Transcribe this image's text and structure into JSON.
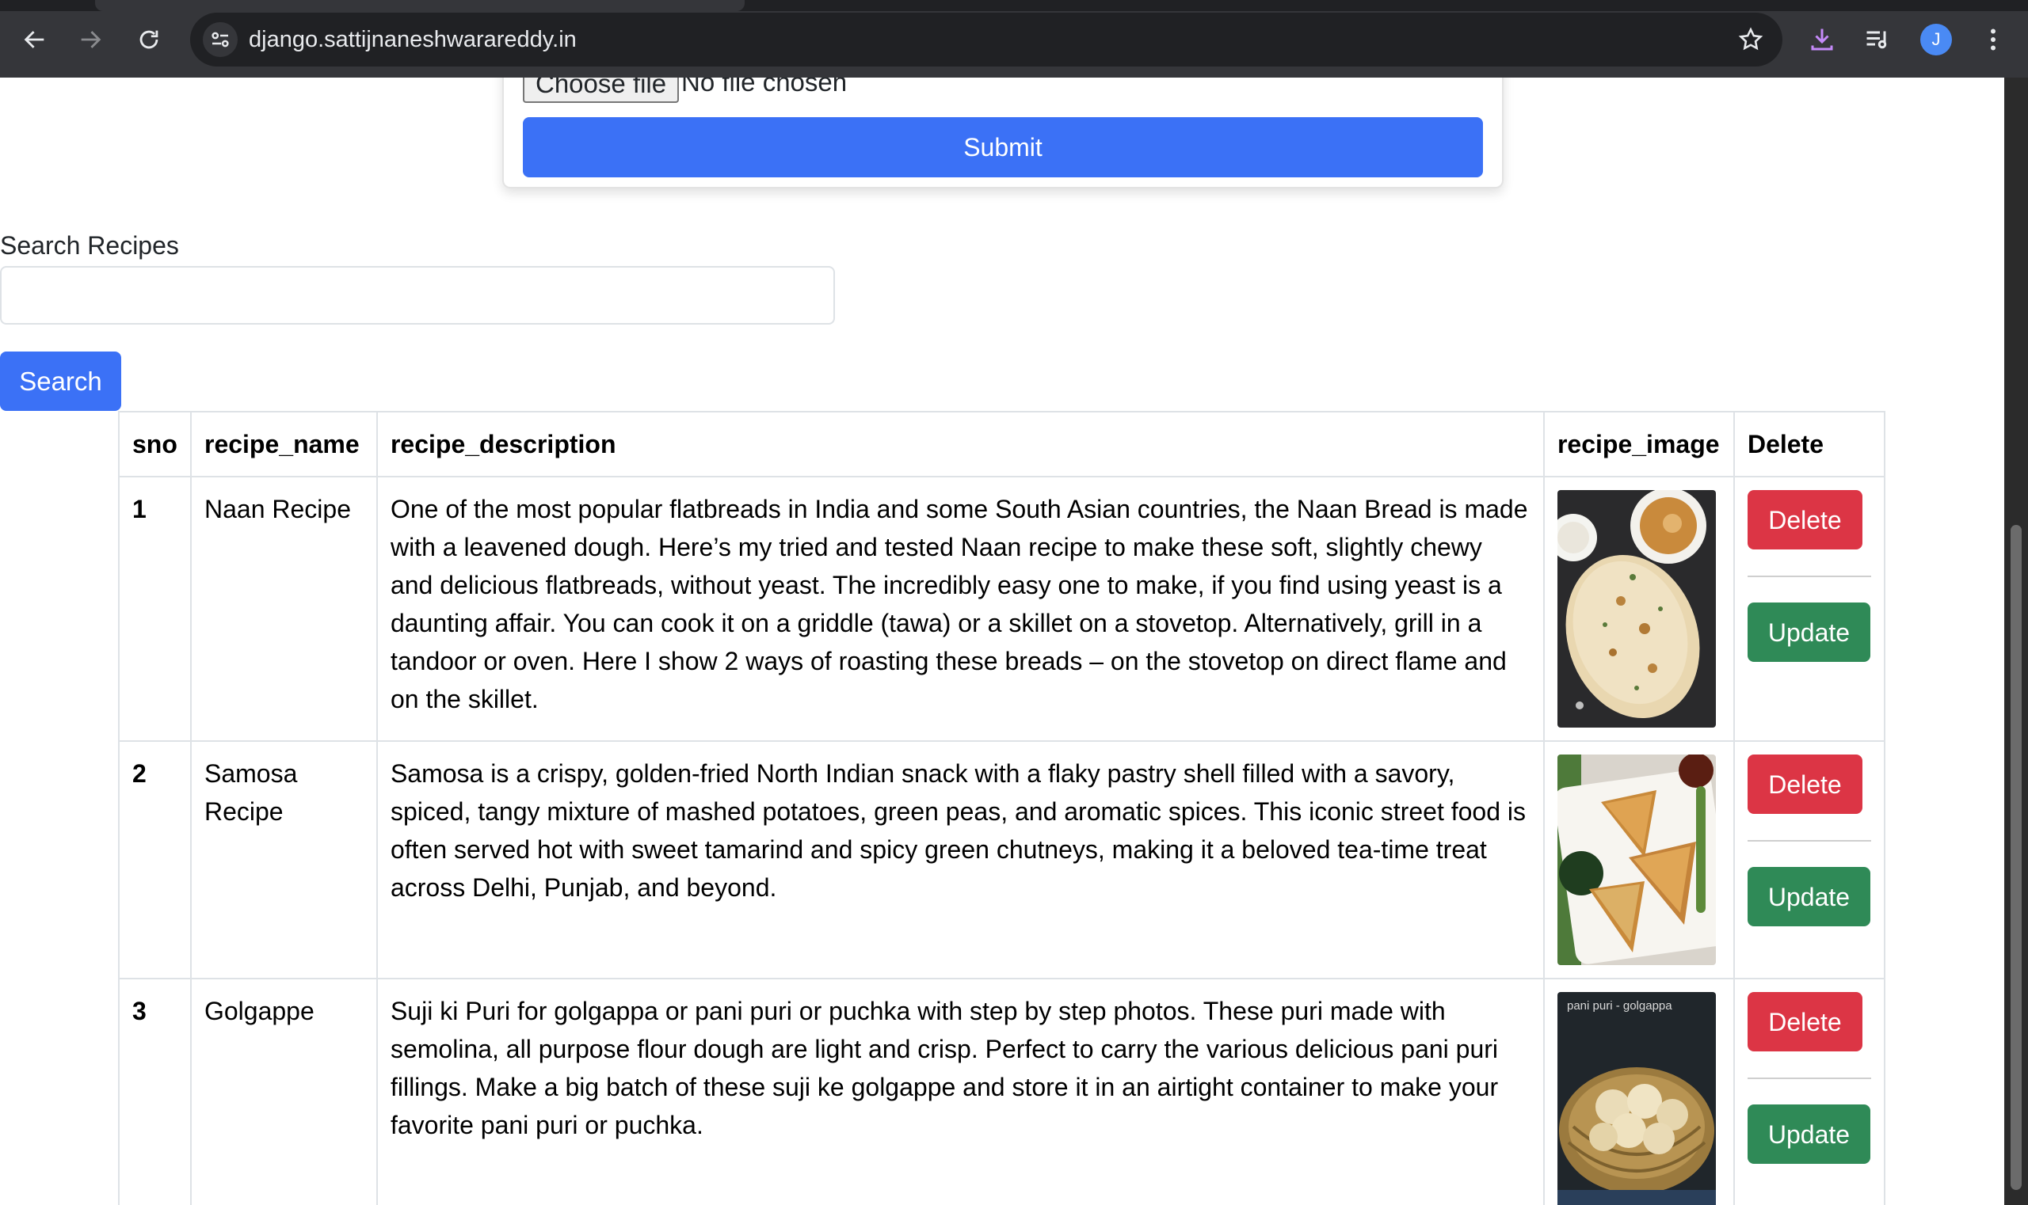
{
  "browser": {
    "url": "django.sattijnaneshwarareddy.in",
    "profile_initial": "J"
  },
  "upload_form": {
    "choose_file_label": "Choose file",
    "file_status": "No file chosen",
    "submit_label": "Submit"
  },
  "search": {
    "label": "Search Recipes",
    "value": "",
    "button_label": "Search"
  },
  "table": {
    "headers": {
      "sno": "sno",
      "recipe_name": "recipe_name",
      "recipe_description": "recipe_description",
      "recipe_image": "recipe_image",
      "delete": "Delete"
    },
    "rows": [
      {
        "sno": "1",
        "recipe_name": "Naan Recipe",
        "recipe_description": "One of the most popular flatbreads in India and some South Asian countries, the Naan Bread is made with a leavened dough. Here’s my tried and tested Naan recipe to make these soft, slightly chewy and delicious flatbreads, without yeast. The incredibly easy one to make, if you find using yeast is a daunting affair. You can cook it on a griddle (tawa) or a skillet on a stovetop. Alternatively, grill in a tandoor or oven. Here I show 2 ways of roasting these breads – on the stovetop on direct flame and on the skillet.",
        "image_subject": "naan",
        "delete_label": "Delete",
        "update_label": "Update"
      },
      {
        "sno": "2",
        "recipe_name": "Samosa Recipe",
        "recipe_description": "Samosa is a crispy, golden-fried North Indian snack with a flaky pastry shell filled with a savory, spiced, tangy mixture of mashed potatoes, green peas, and aromatic spices. This iconic street food is often served hot with sweet tamarind and spicy green chutneys, making it a beloved tea-time treat across Delhi, Punjab, and beyond.",
        "image_subject": "samosa",
        "delete_label": "Delete",
        "update_label": "Update"
      },
      {
        "sno": "3",
        "recipe_name": "Golgappe",
        "recipe_description": "Suji ki Puri for golgappa or pani puri or puchka with step by step photos. These puri made with semolina, all purpose flour dough are light and crisp. Perfect to carry the various delicious pani puri fillings. Make a big batch of these suji ke golgappe and store it in an airtight container to make your favorite pani puri or puchka.",
        "image_subject": "golgappa",
        "image_caption": "pani puri - golgappa",
        "delete_label": "Delete",
        "update_label": "Update"
      }
    ]
  },
  "colors": {
    "primary": "#3b71f6",
    "danger": "#dc3545",
    "success": "#2f8a57"
  }
}
